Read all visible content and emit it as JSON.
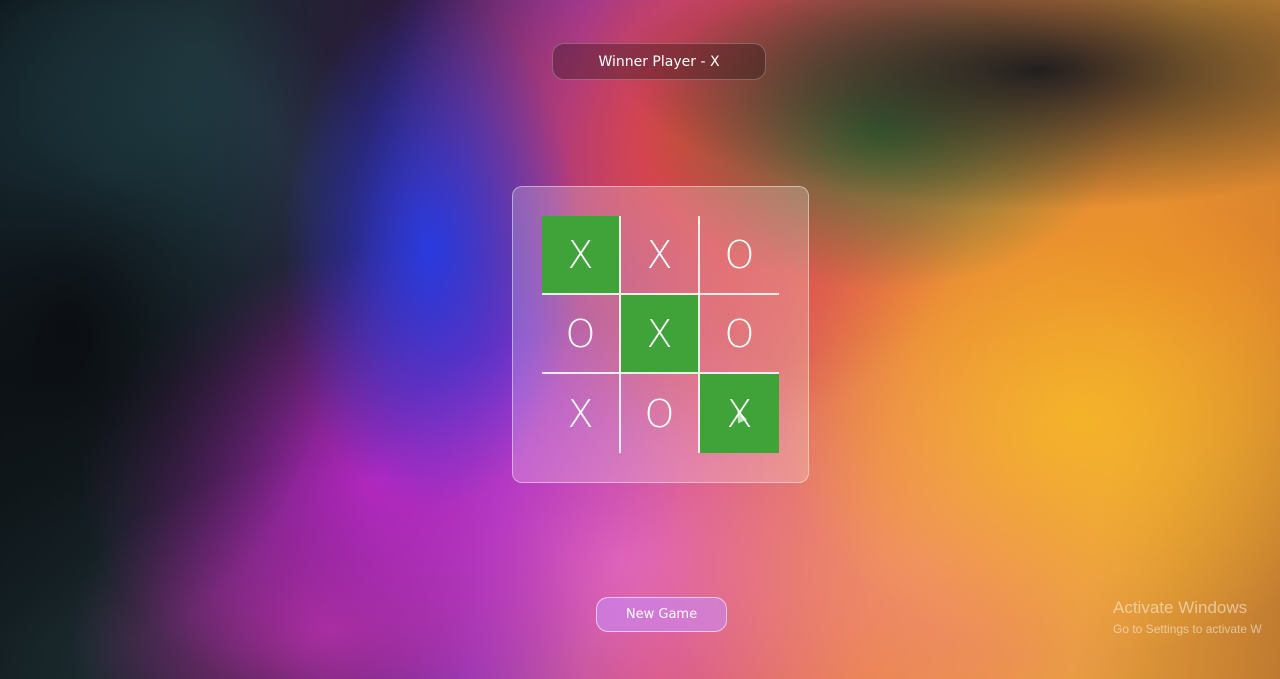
{
  "status": {
    "text": "Winner Player - X"
  },
  "board": {
    "cells": [
      {
        "mark": "X",
        "win": true
      },
      {
        "mark": "X",
        "win": false
      },
      {
        "mark": "O",
        "win": false
      },
      {
        "mark": "O",
        "win": false
      },
      {
        "mark": "X",
        "win": true
      },
      {
        "mark": "O",
        "win": false
      },
      {
        "mark": "X",
        "win": false
      },
      {
        "mark": "O",
        "win": false
      },
      {
        "mark": "X",
        "win": true
      }
    ],
    "win_color": "#3fa33a"
  },
  "controls": {
    "new_game_label": "New Game"
  },
  "watermark": {
    "title": "Activate Windows",
    "subtitle": "Go to Settings to activate W"
  }
}
